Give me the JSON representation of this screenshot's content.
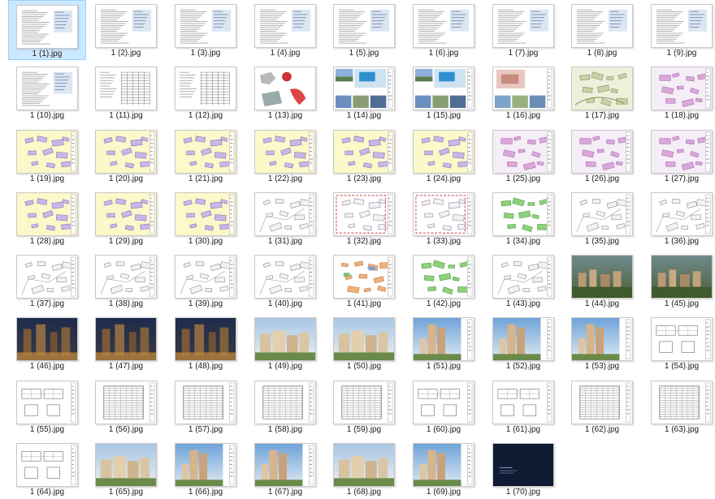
{
  "files": [
    {
      "name": "1 (1).jpg",
      "kind": "doc",
      "selected": true
    },
    {
      "name": "1 (2).jpg",
      "kind": "doc"
    },
    {
      "name": "1 (3).jpg",
      "kind": "doc"
    },
    {
      "name": "1 (4).jpg",
      "kind": "doc"
    },
    {
      "name": "1 (5).jpg",
      "kind": "doc"
    },
    {
      "name": "1 (6).jpg",
      "kind": "doc"
    },
    {
      "name": "1 (7).jpg",
      "kind": "doc"
    },
    {
      "name": "1 (8).jpg",
      "kind": "doc"
    },
    {
      "name": "1 (9).jpg",
      "kind": "doc"
    },
    {
      "name": "1 (10).jpg",
      "kind": "doc"
    },
    {
      "name": "1 (11).jpg",
      "kind": "table"
    },
    {
      "name": "1 (12).jpg",
      "kind": "table"
    },
    {
      "name": "1 (13).jpg",
      "kind": "mapred"
    },
    {
      "name": "1 (14).jpg",
      "kind": "collage"
    },
    {
      "name": "1 (15).jpg",
      "kind": "collage"
    },
    {
      "name": "1 (16).jpg",
      "kind": "collage2"
    },
    {
      "name": "1 (17).jpg",
      "kind": "siteplan"
    },
    {
      "name": "1 (18).jpg",
      "kind": "planpink"
    },
    {
      "name": "1 (19).jpg",
      "kind": "planyellow"
    },
    {
      "name": "1 (20).jpg",
      "kind": "planyellow"
    },
    {
      "name": "1 (21).jpg",
      "kind": "planyellow"
    },
    {
      "name": "1 (22).jpg",
      "kind": "planyellow"
    },
    {
      "name": "1 (23).jpg",
      "kind": "planyellow"
    },
    {
      "name": "1 (24).jpg",
      "kind": "planyellow"
    },
    {
      "name": "1 (25).jpg",
      "kind": "planpink"
    },
    {
      "name": "1 (26).jpg",
      "kind": "planpink"
    },
    {
      "name": "1 (27).jpg",
      "kind": "planpink"
    },
    {
      "name": "1 (28).jpg",
      "kind": "planyellow"
    },
    {
      "name": "1 (29).jpg",
      "kind": "planyellow"
    },
    {
      "name": "1 (30).jpg",
      "kind": "planyellow"
    },
    {
      "name": "1 (31).jpg",
      "kind": "planline"
    },
    {
      "name": "1 (32).jpg",
      "kind": "planred"
    },
    {
      "name": "1 (33).jpg",
      "kind": "planred"
    },
    {
      "name": "1 (34).jpg",
      "kind": "plangreen"
    },
    {
      "name": "1 (35).jpg",
      "kind": "planline"
    },
    {
      "name": "1 (36).jpg",
      "kind": "planline"
    },
    {
      "name": "1 (37).jpg",
      "kind": "planline"
    },
    {
      "name": "1 (38).jpg",
      "kind": "planline"
    },
    {
      "name": "1 (39).jpg",
      "kind": "planline"
    },
    {
      "name": "1 (40).jpg",
      "kind": "planline"
    },
    {
      "name": "1 (41).jpg",
      "kind": "plancolor"
    },
    {
      "name": "1 (42).jpg",
      "kind": "plangreen"
    },
    {
      "name": "1 (43).jpg",
      "kind": "planline"
    },
    {
      "name": "1 (44).jpg",
      "kind": "aerial"
    },
    {
      "name": "1 (45).jpg",
      "kind": "aerial"
    },
    {
      "name": "1 (46).jpg",
      "kind": "night"
    },
    {
      "name": "1 (47).jpg",
      "kind": "night"
    },
    {
      "name": "1 (48).jpg",
      "kind": "night"
    },
    {
      "name": "1 (49).jpg",
      "kind": "day"
    },
    {
      "name": "1 (50).jpg",
      "kind": "day"
    },
    {
      "name": "1 (51).jpg",
      "kind": "tower"
    },
    {
      "name": "1 (52).jpg",
      "kind": "tower"
    },
    {
      "name": "1 (53).jpg",
      "kind": "tower"
    },
    {
      "name": "1 (54).jpg",
      "kind": "floorplan"
    },
    {
      "name": "1 (55).jpg",
      "kind": "floorplan"
    },
    {
      "name": "1 (56).jpg",
      "kind": "elevation"
    },
    {
      "name": "1 (57).jpg",
      "kind": "elevation"
    },
    {
      "name": "1 (58).jpg",
      "kind": "elevation"
    },
    {
      "name": "1 (59).jpg",
      "kind": "elevation"
    },
    {
      "name": "1 (60).jpg",
      "kind": "floorplan"
    },
    {
      "name": "1 (61).jpg",
      "kind": "floorplan"
    },
    {
      "name": "1 (62).jpg",
      "kind": "elevation"
    },
    {
      "name": "1 (63).jpg",
      "kind": "elevation"
    },
    {
      "name": "1 (64).jpg",
      "kind": "floorplan"
    },
    {
      "name": "1 (65).jpg",
      "kind": "day"
    },
    {
      "name": "1 (66).jpg",
      "kind": "tower"
    },
    {
      "name": "1 (67).jpg",
      "kind": "tower"
    },
    {
      "name": "1 (68).jpg",
      "kind": "day"
    },
    {
      "name": "1 (69).jpg",
      "kind": "tower"
    },
    {
      "name": "1 (70).jpg",
      "kind": "dark"
    }
  ],
  "colors": {
    "selection_fill": "#cce8ff",
    "selection_border": "#99d1ff",
    "label_text": "#1a1a1a"
  }
}
